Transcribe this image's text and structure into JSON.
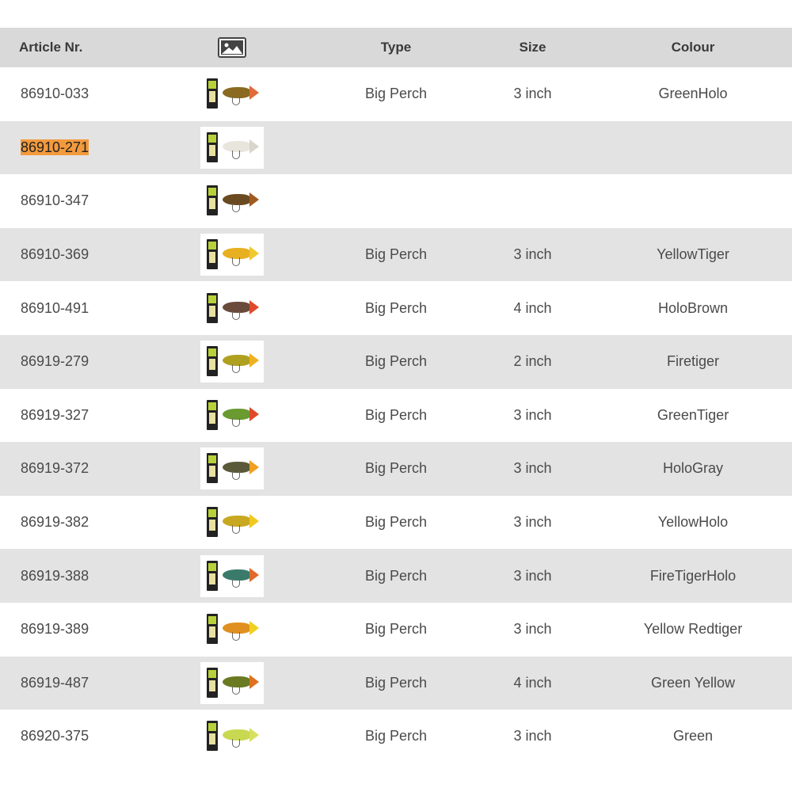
{
  "header": {
    "article": "Article Nr.",
    "image_icon": "image-icon",
    "type": "Type",
    "size": "Size",
    "colour": "Colour"
  },
  "rows": [
    {
      "article": "86910-033",
      "type": "Big Perch",
      "size": "3 inch",
      "colour": "GreenHolo",
      "fish_color": "#8a6a20",
      "tail_color": "#e06a3a"
    },
    {
      "article": "86910-271",
      "type": "",
      "size": "",
      "colour": "",
      "fish_color": "#e8e6dc",
      "tail_color": "#d8d6cc"
    },
    {
      "article": "86910-347",
      "type": "",
      "size": "",
      "colour": "",
      "fish_color": "#6a4a20",
      "tail_color": "#a05a20"
    },
    {
      "article": "86910-369",
      "type": "Big Perch",
      "size": "3 inch",
      "colour": "YellowTiger",
      "fish_color": "#e8b020",
      "tail_color": "#f0c830"
    },
    {
      "article": "86910-491",
      "type": "Big Perch",
      "size": "4 inch",
      "colour": "HoloBrown",
      "fish_color": "#6a4a3a",
      "tail_color": "#e04a2a"
    },
    {
      "article": "86919-279",
      "type": "Big Perch",
      "size": "2 inch",
      "colour": "Firetiger",
      "fish_color": "#b0a020",
      "tail_color": "#f0b020"
    },
    {
      "article": "86919-327",
      "type": "Big Perch",
      "size": "3 inch",
      "colour": "GreenTiger",
      "fish_color": "#6a9a30",
      "tail_color": "#e04a2a"
    },
    {
      "article": "86919-372",
      "type": "Big Perch",
      "size": "3 inch",
      "colour": "HoloGray",
      "fish_color": "#5a5a3a",
      "tail_color": "#f0a020"
    },
    {
      "article": "86919-382",
      "type": "Big Perch",
      "size": "3 inch",
      "colour": "YellowHolo",
      "fish_color": "#c8a820",
      "tail_color": "#f0c820"
    },
    {
      "article": "86919-388",
      "type": "Big Perch",
      "size": "3 inch",
      "colour": "FireTigerHolo",
      "fish_color": "#3a7a6a",
      "tail_color": "#e06a2a"
    },
    {
      "article": "86919-389",
      "type": "Big Perch",
      "size": "3 inch",
      "colour": "Yellow Redtiger",
      "fish_color": "#e09020",
      "tail_color": "#f0d020"
    },
    {
      "article": "86919-487",
      "type": "Big Perch",
      "size": "4 inch",
      "colour": "Green Yellow",
      "fish_color": "#6a7a20",
      "tail_color": "#e07020"
    },
    {
      "article": "86920-375",
      "type": "Big Perch",
      "size": "3 inch",
      "colour": "Green",
      "fish_color": "#c8d850",
      "tail_color": "#d8e060"
    }
  ],
  "highlighted_row": 1,
  "colors": {
    "header_bg": "#d9d9d9",
    "alt_row_bg": "#e3e3e3",
    "highlight": "#f39a3c"
  }
}
